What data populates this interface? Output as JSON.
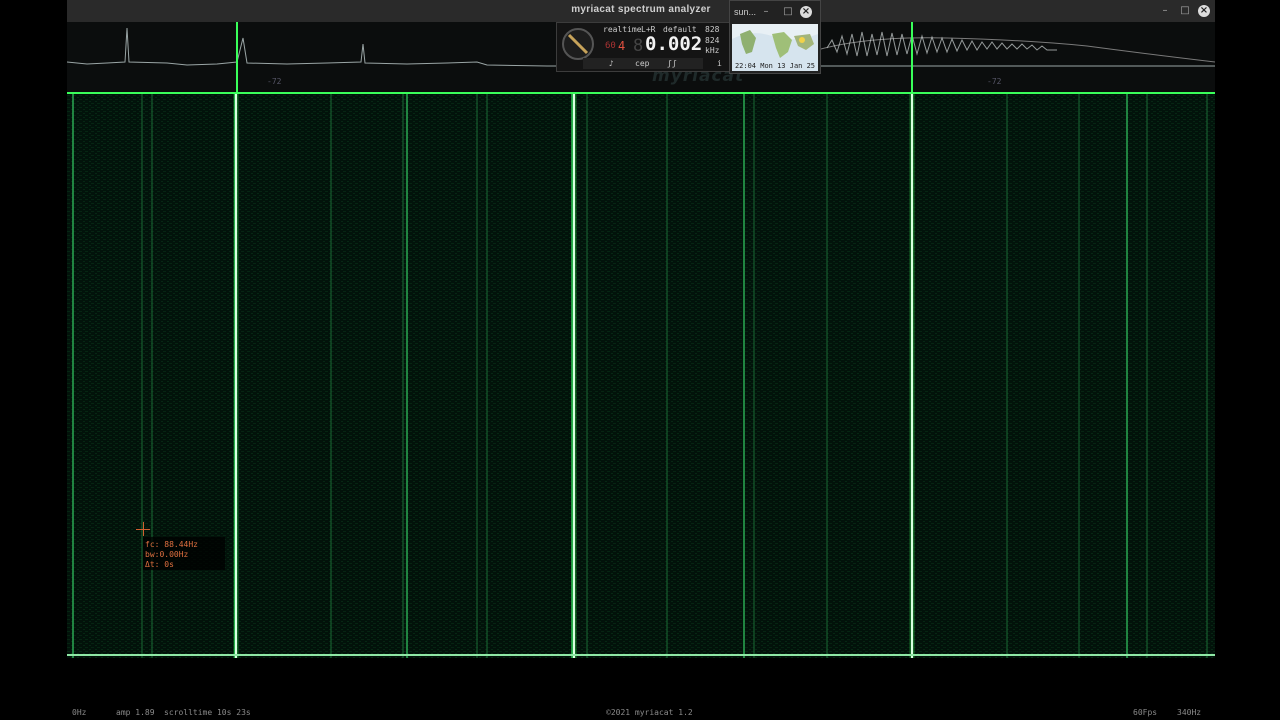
{
  "window": {
    "title": "myriacat spectrum analyzer"
  },
  "sun_window": {
    "title": "sun...",
    "timestamp": "22:04 Mon 13 Jan 25"
  },
  "controls": {
    "mode": "realtime",
    "channel": "L+R",
    "preset": "default",
    "bins_top": "828",
    "bins_bottom": "824",
    "gain_label": "60",
    "gain_digit": "4",
    "freq_digit_prefix": "8",
    "freq_value": "0.002",
    "freq_unit": "kHz",
    "btn_tab": "cep",
    "btn_left": "♪",
    "btn_right": "ʃʃ",
    "btn_info": "i"
  },
  "spectrum": {
    "level_left": "-72",
    "level_right": "-72",
    "peaks": [
      0.147,
      0.441,
      0.735,
      0.0
    ]
  },
  "cursor": {
    "fc": "fc: 88.44Hz",
    "bw": "bw:0.00Hz",
    "dt": "Δt: 0s"
  },
  "status": {
    "min_freq": "0Hz",
    "amp": "amp 1.89",
    "scrolltime": "scrolltime 10s 23s",
    "copyright": "©2021 myriacat 1.2",
    "fps": "60Fps",
    "max_freq": "340Hz"
  },
  "watermark": "myriacat",
  "colors": {
    "accent": "#39ff5a",
    "titlebar": "#2a2a2a",
    "cursor": "#e07040"
  },
  "icons": [
    "minimize-icon",
    "maximize-icon",
    "close-icon",
    "dial-icon"
  ]
}
